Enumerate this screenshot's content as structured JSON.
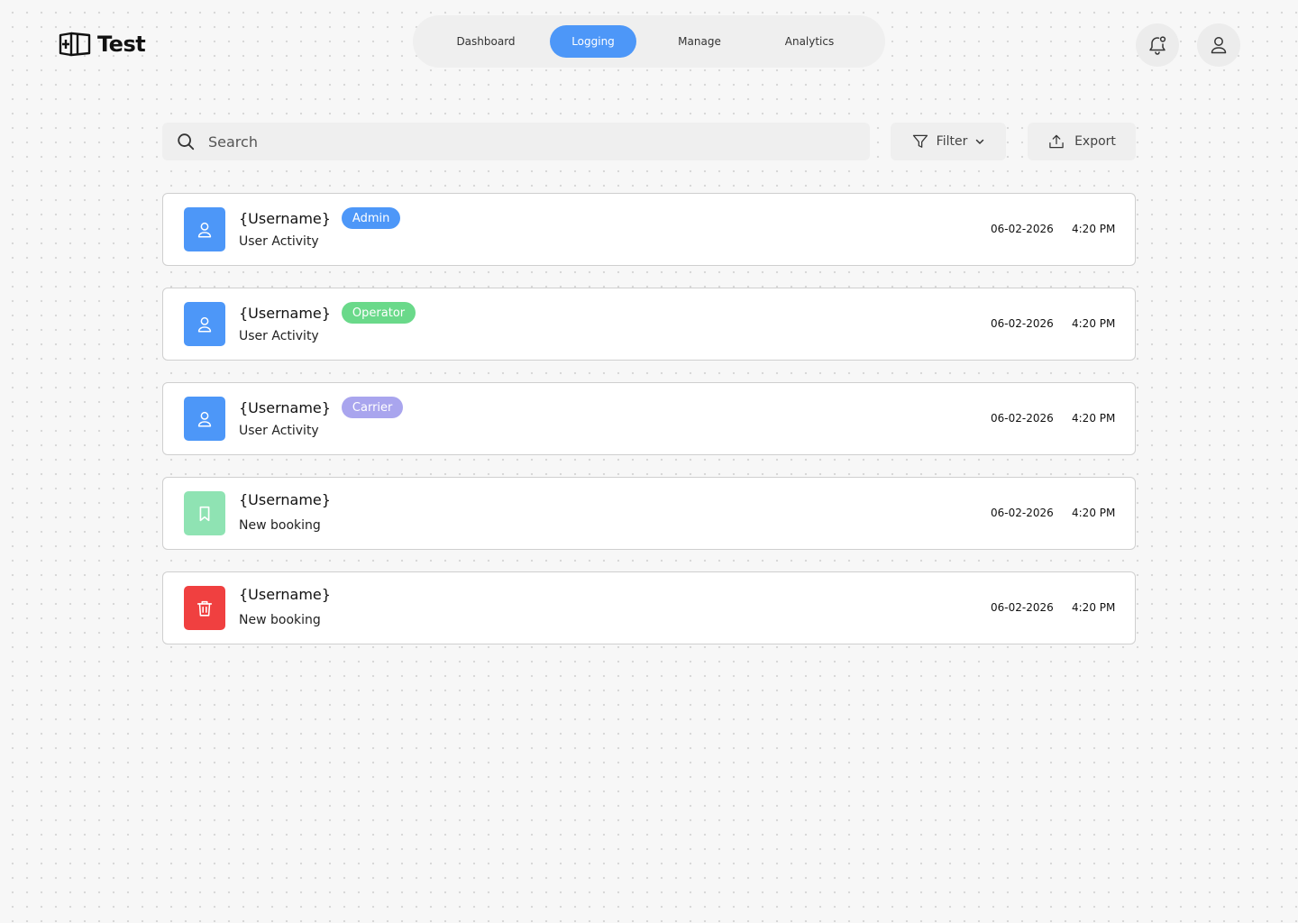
{
  "brand": {
    "name": "Test"
  },
  "nav": {
    "items": [
      {
        "label": "Dashboard",
        "active": false
      },
      {
        "label": "Logging",
        "active": true
      },
      {
        "label": "Manage",
        "active": false
      },
      {
        "label": "Analytics",
        "active": false
      }
    ]
  },
  "header_icons": [
    "bell-icon",
    "user-icon"
  ],
  "toolbar": {
    "search_placeholder": "Search",
    "filter_label": "Filter",
    "export_label": "Export"
  },
  "colors": {
    "accent": "#4d97f8",
    "admin_badge": "#4d97f8",
    "operator_badge": "#6ad98a",
    "carrier_badge": "#a9a5ee",
    "booking_icon_bg": "#8fe3b3",
    "delete_icon_bg": "#f04040"
  },
  "logs": [
    {
      "icon": "user-icon",
      "icon_bg": "#4d97f8",
      "username": "{Username}",
      "role": "Admin",
      "role_color": "#4d97f8",
      "activity": "User Activity",
      "date": "06-02-2026",
      "time": "4:20 PM"
    },
    {
      "icon": "user-icon",
      "icon_bg": "#4d97f8",
      "username": "{Username}",
      "role": "Operator",
      "role_color": "#6ad98a",
      "activity": "User Activity",
      "date": "06-02-2026",
      "time": "4:20 PM"
    },
    {
      "icon": "user-icon",
      "icon_bg": "#4d97f8",
      "username": "{Username}",
      "role": "Carrier",
      "role_color": "#a9a5ee",
      "activity": "User Activity",
      "date": "06-02-2026",
      "time": "4:20 PM"
    },
    {
      "icon": "bookmark-icon",
      "icon_bg": "#8fe3b3",
      "username": "{Username}",
      "role": "",
      "role_color": "",
      "activity": "New booking",
      "date": "06-02-2026",
      "time": "4:20 PM"
    },
    {
      "icon": "trash-icon",
      "icon_bg": "#f04040",
      "username": "{Username}",
      "role": "",
      "role_color": "",
      "activity": "New booking",
      "date": "06-02-2026",
      "time": "4:20 PM"
    }
  ]
}
